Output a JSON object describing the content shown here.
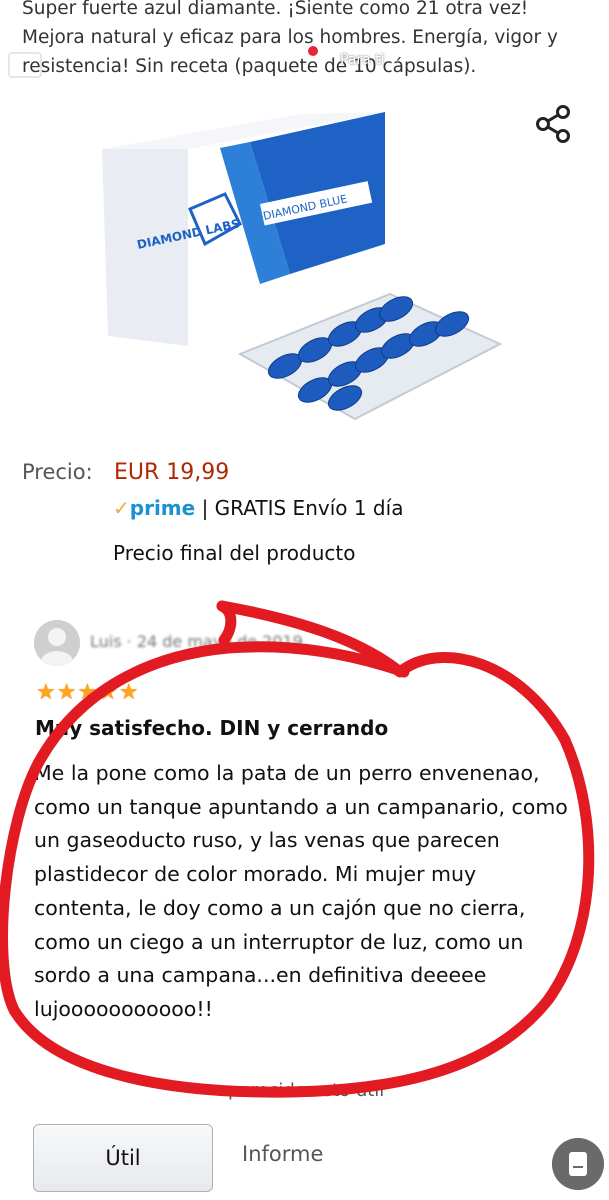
{
  "product": {
    "title": "Super fuerte azul diamante. ¡Siente como 21 otra vez! Mejora natural y eficaz para los hombres. Energía, vigor y resistencia! Sin receta (paquete de 10 cápsulas).",
    "brand_logo": "DIAMOND LABS",
    "box_label": "DIAMOND BLUE"
  },
  "overlay": {
    "partial_text": "Para ti"
  },
  "price": {
    "label": "Precio:",
    "value": "EUR 19,99",
    "prime_check": "✓",
    "prime_word": "prime",
    "shipping": "| GRATIS Envío 1 día",
    "final_note": "Precio final del producto"
  },
  "review": {
    "reviewer": "Luis · 24 de mayo de 2019",
    "rating": 5,
    "stars_text": "★★★★★",
    "title": "Muy satisfecho. DIN y cerrando",
    "body": "Me la pone como la pata de un perro envenenao, como un tanque apuntando a un campanario, como un gaseoducto ruso, y las venas que parecen plastidecor de color morado. Mi mujer muy contenta, le doy como a un cajón que no cierra, como un ciego a un interruptor de luz, como un sordo a una campana...en definitiva deeeee lujooooooooooo!!",
    "helpful_text": "parecido esto útil"
  },
  "actions": {
    "helpful_button": "Útil",
    "report_button": "Informe"
  },
  "icons": {
    "share": "share-icon",
    "search": "search-icon",
    "avatar": "user-avatar-icon",
    "fab": "document-icon"
  },
  "colors": {
    "price": "#b12704",
    "prime_blue": "#1b91d1",
    "prime_check": "#f3a847",
    "stars": "#ffa41c",
    "annotation_red": "#e21b23"
  }
}
